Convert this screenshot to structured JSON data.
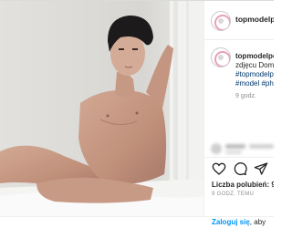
{
  "post": {
    "username": "topmodelpo",
    "photo": {
      "description_icon": "portrait-photo"
    },
    "caption": {
      "username": "topmodelpo",
      "line1": "zdjęcu Dom",
      "line2": "#topmodelp",
      "line3": "#model #ph"
    },
    "caption_time": "9 godz.",
    "actions": {
      "like_icon": "heart-icon",
      "comment_icon": "comment-icon",
      "share_icon": "send-icon"
    },
    "likes": {
      "label": "Liczba polubień:",
      "count": "9 4"
    },
    "time": "9 GODZ. TEMU"
  },
  "login_bar": {
    "link": "Zaloguj się",
    "rest": ", aby"
  },
  "colors": {
    "link": "#0095f6",
    "hashtag": "#00376b",
    "text": "#262626",
    "muted": "#8e8e8e",
    "avatar_ring": "#e8a0b5"
  }
}
